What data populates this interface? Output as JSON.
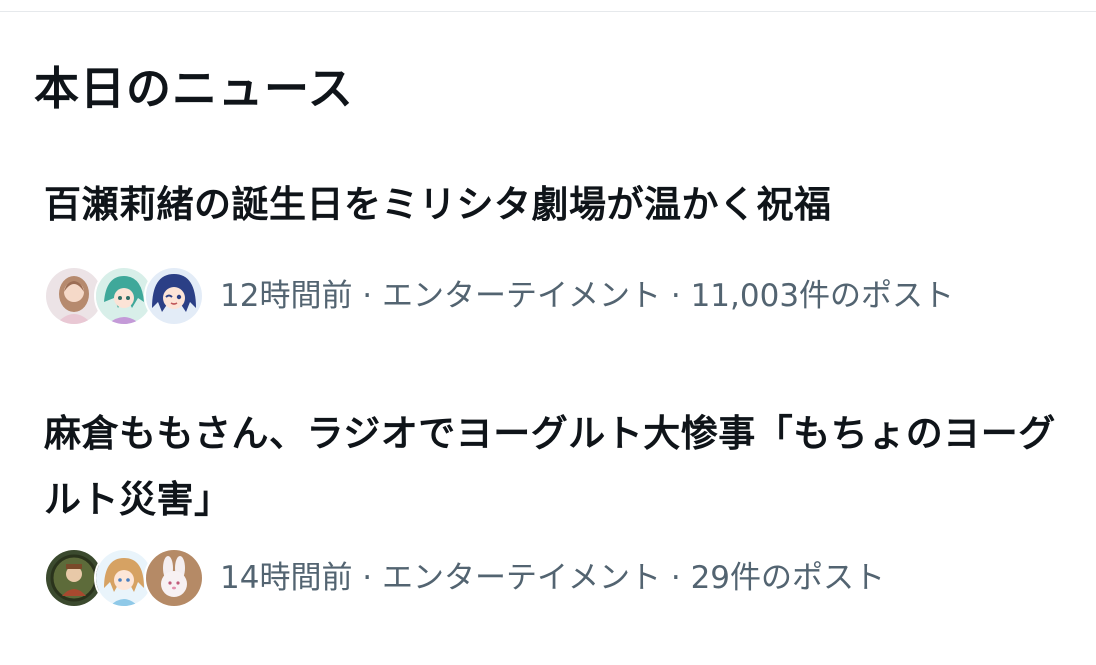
{
  "section": {
    "title": "本日のニュース"
  },
  "news": [
    {
      "headline": "百瀬莉緒の誕生日をミリシタ劇場が温かく祝福",
      "time": "12時間前",
      "category": "エンターテイメント",
      "posts": "11,003件のポスト",
      "separator": " · ",
      "meta_line": "12時間前 · エンターテイメント · 11,003件のポスト"
    },
    {
      "headline": "麻倉ももさん、ラジオでヨーグルト大惨事「もちょのヨーグルト災害」",
      "time": "14時間前",
      "category": "エンターテイメント",
      "posts": "29件のポスト",
      "separator": " · ",
      "meta_line": "14時間前 · エンターテイメント · 29件のポスト"
    }
  ],
  "colors": {
    "text_primary": "#0f1419",
    "text_secondary": "#536471",
    "divider": "#e6e9ec",
    "background": "#ffffff"
  }
}
